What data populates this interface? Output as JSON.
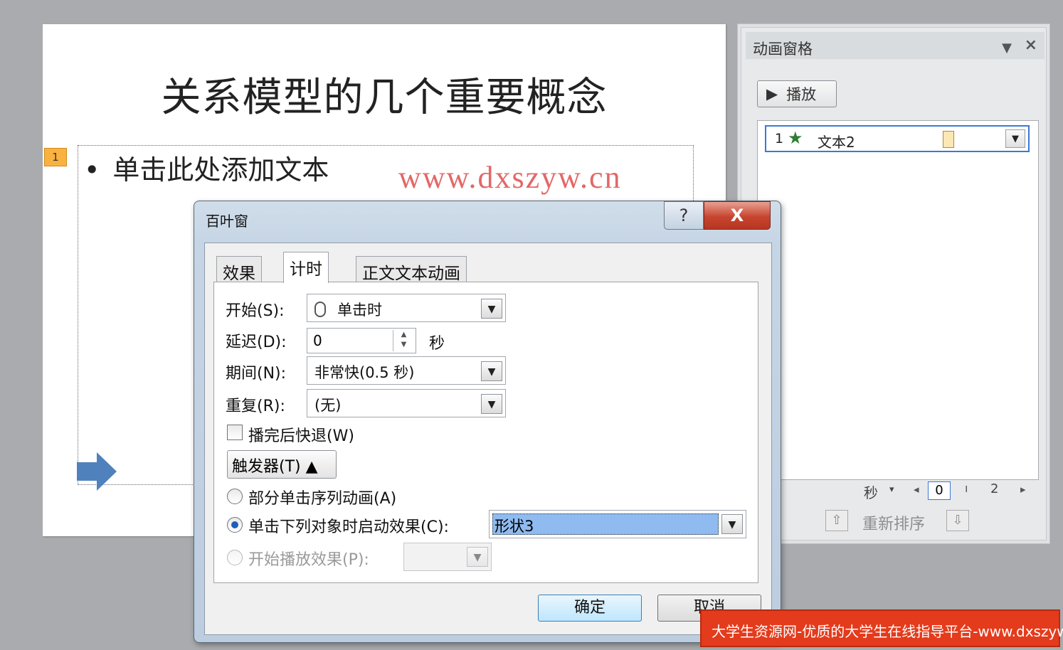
{
  "slide": {
    "title": "关系模型的几个重要概念",
    "anim_tag": "1",
    "bullet_symbol": "•",
    "bullet_text": "单击此处添加文本",
    "watermark": "www.dxszyw.cn",
    "arrow_color": "#4f81bd"
  },
  "pane": {
    "title": "动画窗格",
    "dropdown_icon": "triangle-down",
    "close_icon": "×",
    "play_icon": "▶",
    "play_label": "播放",
    "item": {
      "number": "1",
      "icon": "★",
      "label": "文本2",
      "dropdown": "▼"
    },
    "timeline": {
      "unit": "秒",
      "unit_dd": "▾",
      "left_arrow": "◂",
      "start": "0",
      "tick": "ı",
      "end": "2",
      "right_arrow": "▸"
    },
    "reorder_up": "⇧",
    "reorder_label": "重新排序",
    "reorder_down": "⇩"
  },
  "dialog": {
    "title": "百叶窗",
    "help": "?",
    "close": "X",
    "tabs": [
      "效果",
      "计时",
      "正文文本动画"
    ],
    "active_tab": "计时",
    "start_label": "开始(S):",
    "start_value": "单击时",
    "delay_label": "延迟(D):",
    "delay_value": "0",
    "delay_unit": "秒",
    "duration_label": "期间(N):",
    "duration_value": "非常快(0.5 秒)",
    "repeat_label": "重复(R):",
    "repeat_value": "(无)",
    "rewind_label": "播完后快退(W)",
    "rewind_checked": false,
    "trigger_label": "触发器(T) ▲",
    "radio_sequence": "部分单击序列动画(A)",
    "radio_click": "单击下列对象时启动效果(C):",
    "click_object": "形状3",
    "radio_play": "开始播放效果(P):",
    "ok": "确定",
    "cancel": "取消",
    "combo_arrow": "▼",
    "spin_up": "▲",
    "spin_down": "▼"
  },
  "banner": {
    "text": "大学生资源网-优质的大学生在线指导平台-www.dxszyw.cn",
    "color": "#e43b1c"
  }
}
